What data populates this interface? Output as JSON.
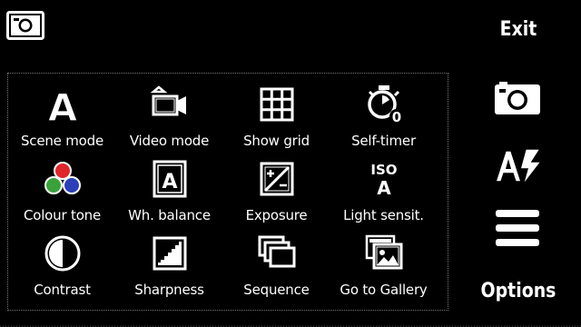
{
  "softkeys": {
    "exit_label": "Exit",
    "options_label": "Options"
  },
  "top_icon": "camera-icon",
  "menu": [
    {
      "label": "Scene mode",
      "icon": "scene-mode-icon"
    },
    {
      "label": "Video mode",
      "icon": "video-camera-icon"
    },
    {
      "label": "Show grid",
      "icon": "grid-icon"
    },
    {
      "label": "Self-timer",
      "icon": "self-timer-icon"
    },
    {
      "label": "Colour tone",
      "icon": "colour-tone-icon"
    },
    {
      "label": "Wh. balance",
      "icon": "white-balance-icon"
    },
    {
      "label": "Exposure",
      "icon": "exposure-icon"
    },
    {
      "label": "Light sensit.",
      "icon": "iso-icon"
    },
    {
      "label": "Contrast",
      "icon": "contrast-icon"
    },
    {
      "label": "Sharpness",
      "icon": "sharpness-icon"
    },
    {
      "label": "Sequence",
      "icon": "sequence-icon"
    },
    {
      "label": "Go to Gallery",
      "icon": "gallery-icon"
    }
  ],
  "side_toolbar": [
    "camera-icon",
    "flash-auto-icon",
    "menu-icon"
  ],
  "self_timer_value": "0",
  "iso_text": "ISO",
  "iso_value": "A",
  "scene_letter": "A",
  "wb_letter": "A",
  "colors": {
    "background": "#000000",
    "foreground": "#ffffff",
    "tone_red": "#e0262b",
    "tone_green": "#3aa23a",
    "tone_blue": "#2a3fb8"
  }
}
